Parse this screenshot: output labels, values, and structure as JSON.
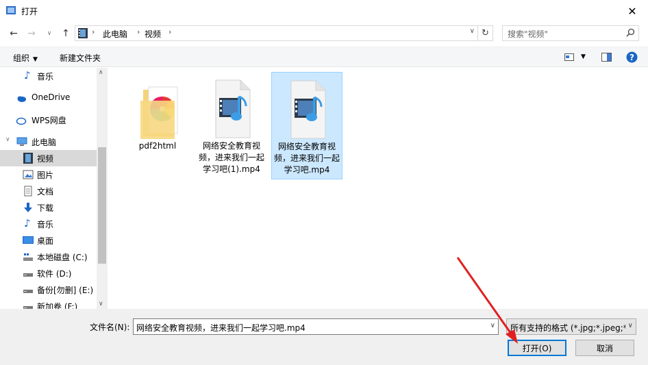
{
  "window": {
    "title": "打开"
  },
  "address": {
    "crumbs": [
      "此电脑",
      "视频"
    ]
  },
  "search": {
    "placeholder": "搜索\"视频\""
  },
  "toolbar": {
    "organize": "组织",
    "new_folder": "新建文件夹"
  },
  "sidebar": {
    "items": [
      {
        "label": "音乐",
        "icon": "music-note-icon"
      },
      {
        "label": "OneDrive",
        "icon": "cloud-icon"
      },
      {
        "label": "WPS网盘",
        "icon": "wps-cloud-icon"
      },
      {
        "label": "此电脑",
        "icon": "computer-icon"
      },
      {
        "label": "视频",
        "icon": "video-icon",
        "selected": true
      },
      {
        "label": "图片",
        "icon": "pictures-icon"
      },
      {
        "label": "文档",
        "icon": "document-icon"
      },
      {
        "label": "下载",
        "icon": "download-icon"
      },
      {
        "label": "音乐",
        "icon": "music-note-icon"
      },
      {
        "label": "桌面",
        "icon": "desktop-icon"
      },
      {
        "label": "本地磁盘 (C:)",
        "icon": "drive-c-icon"
      },
      {
        "label": "软件 (D:)",
        "icon": "drive-icon"
      },
      {
        "label": "备份[勿删] (E:)",
        "icon": "drive-icon"
      },
      {
        "label": "新加卷 (F:)",
        "icon": "drive-icon"
      }
    ]
  },
  "files": [
    {
      "name": "pdf2html",
      "type": "folder",
      "icon": "pinwheel-folder-icon"
    },
    {
      "name": "网络安全教育视频，进来我们一起学习吧(1).mp4",
      "type": "video",
      "icon": "video-file-icon"
    },
    {
      "name": "网络安全教育视频，进来我们一起学习吧.mp4",
      "type": "video",
      "icon": "video-file-icon",
      "selected": true
    }
  ],
  "footer": {
    "filename_label": "文件名(N):",
    "filename_value": "网络安全教育视频，进来我们一起学习吧.mp4",
    "filetype_value": "所有支持的格式 (*.jpg;*.jpeg;*",
    "open_button": "打开(O)",
    "cancel_button": "取消"
  },
  "colors": {
    "accent": "#0078d7",
    "selection": "#cce8ff",
    "arrow": "#e02020"
  }
}
